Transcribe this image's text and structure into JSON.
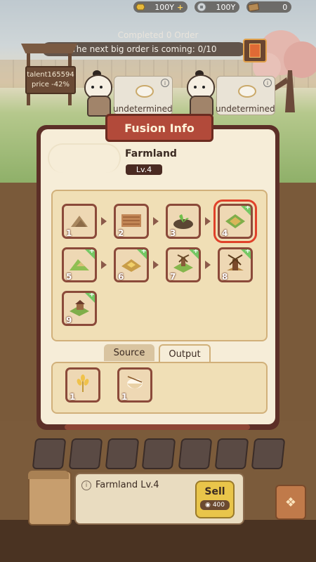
{
  "resources": {
    "gold": {
      "value": "100Y",
      "icon": "gold-ingot-icon"
    },
    "coin": {
      "value": "100Y",
      "icon": "coin-icon"
    },
    "ticket": {
      "value": "0",
      "icon": "ticket-icon"
    },
    "plus": "+"
  },
  "order": {
    "completed": "Completed 0 Order",
    "next": "The next big order is coming: 0/10"
  },
  "talent": {
    "line1": "talent165594",
    "line2": "price -42%"
  },
  "slots": [
    {
      "status": "undetermined"
    },
    {
      "status": "undetermined"
    }
  ],
  "dialog": {
    "title": "Fusion Info",
    "item_name": "Farmland",
    "level": "Lv.4",
    "tabs": {
      "source": "Source",
      "output": "Output"
    }
  },
  "chain": [
    {
      "num": "1",
      "icon": "dirt-pile-icon"
    },
    {
      "num": "2",
      "icon": "plowed-soil-icon"
    },
    {
      "num": "3",
      "icon": "sprout-icon"
    },
    {
      "num": "4",
      "icon": "farmland-icon",
      "selected": true,
      "new": true
    },
    {
      "num": "5",
      "icon": "hill-icon",
      "new": true
    },
    {
      "num": "6",
      "icon": "wheat-field-icon",
      "new": true
    },
    {
      "num": "7",
      "icon": "windmill-field-icon",
      "new": true
    },
    {
      "num": "8",
      "icon": "windmill-icon",
      "new": true
    },
    {
      "num": "9",
      "icon": "farmhouse-icon",
      "new": true
    }
  ],
  "outputs": [
    {
      "num": "1",
      "icon": "wheat-icon"
    },
    {
      "num": "1",
      "icon": "rice-bowl-icon"
    }
  ],
  "detail": {
    "label": "Farmland Lv.4",
    "sell_label": "Sell",
    "sell_price": "400"
  },
  "colors": {
    "accent": "#b24a3a",
    "panel": "#f6edd8",
    "new_tag": "#74c764",
    "select": "#e0412a"
  }
}
